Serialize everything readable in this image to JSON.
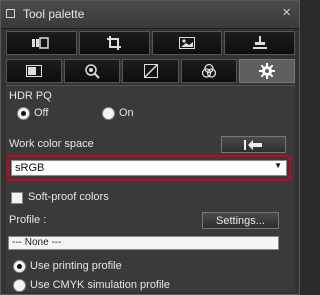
{
  "window": {
    "title": "Tool palette",
    "close_glyph": "×"
  },
  "toolbar": {
    "row1": [
      {
        "icon": "film-strip-icon"
      },
      {
        "icon": "crop-icon"
      },
      {
        "icon": "image-icon"
      },
      {
        "icon": "stamp-icon"
      }
    ],
    "row2": [
      {
        "icon": "basic-adjust-icon"
      },
      {
        "icon": "detail-zoom-icon"
      },
      {
        "icon": "tone-curve-icon"
      },
      {
        "icon": "color-adjust-icon"
      },
      {
        "icon": "gear-icon",
        "active": true
      }
    ]
  },
  "hdr": {
    "label": "HDR PQ",
    "off_label": "Off",
    "on_label": "On",
    "selected": "Off"
  },
  "work_color_space": {
    "label": "Work color space",
    "reset_icon": "reset-arrow-icon",
    "value": "sRGB",
    "highlight_color": "#d0021b"
  },
  "soft_proof": {
    "label": "Soft-proof colors",
    "checked": false
  },
  "profile": {
    "label": "Profile :",
    "settings_label": "Settings...",
    "value": "---  None  ---",
    "options": [
      "Use printing profile",
      "Use CMYK simulation profile"
    ],
    "selected": "Use printing profile"
  }
}
